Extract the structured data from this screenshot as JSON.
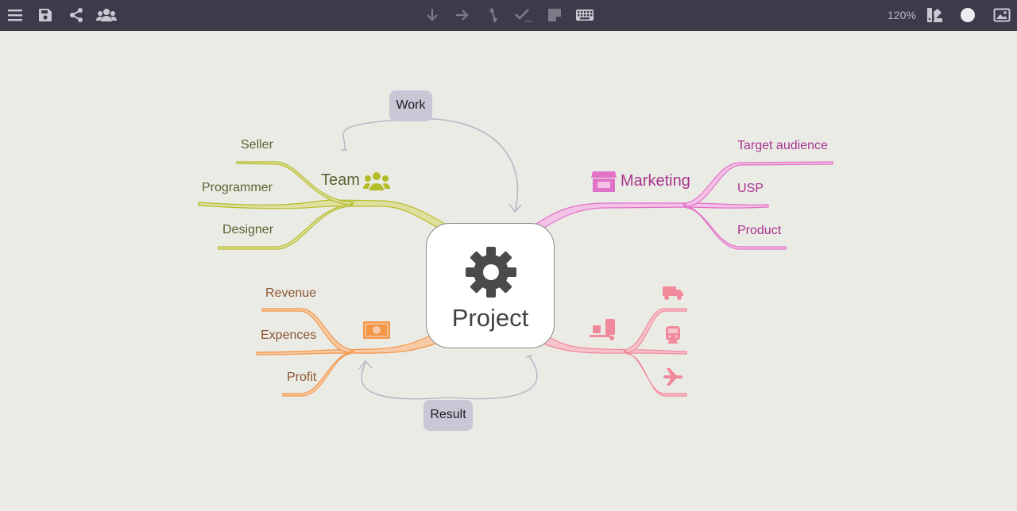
{
  "toolbar": {
    "left_icons": [
      "menu-icon",
      "save-icon",
      "share-icon",
      "users-icon"
    ],
    "center_icons": [
      "arrow-down-icon",
      "arrow-right-icon",
      "relationship-icon",
      "task-icon",
      "note-icon",
      "keyboard-icon"
    ],
    "zoom": "120%",
    "right_icons": [
      "theme-icon",
      "color-icon",
      "image-icon"
    ]
  },
  "map": {
    "central": {
      "label": "Project",
      "icon": "gear-icon"
    },
    "team": {
      "label": "Team",
      "icon": "users-icon",
      "color": "#b5bc2a",
      "children": [
        "Seller",
        "Programmer",
        "Designer"
      ]
    },
    "marketing": {
      "label": "Marketing",
      "icon": "store-icon",
      "color": "#e072c8",
      "children": [
        "Target audience",
        "USP",
        "Product"
      ]
    },
    "finance": {
      "icon": "money-icon",
      "color": "#f59546",
      "children": [
        "Revenue",
        "Expences",
        "Profit"
      ]
    },
    "logistics": {
      "icon": "loading-icon",
      "color": "#f08a9b",
      "children_icons": [
        "truck-icon",
        "train-icon",
        "plane-icon"
      ]
    },
    "relations": [
      {
        "label": "Work"
      },
      {
        "label": "Result"
      }
    ]
  },
  "colors": {
    "toolbar_bg": "#3d3b4a",
    "canvas_bg": "#ebebe6",
    "relation_label_bg": "#cac6d6"
  }
}
